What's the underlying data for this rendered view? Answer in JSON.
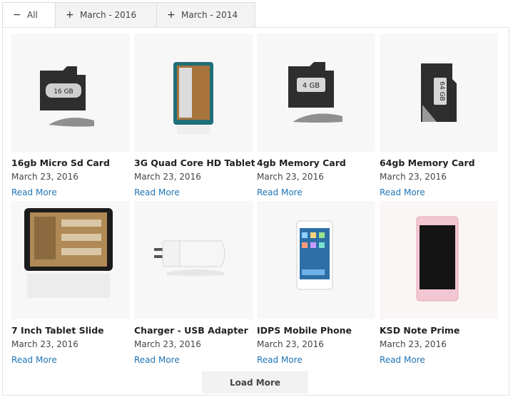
{
  "tabs": [
    {
      "sign": "−",
      "label": "All"
    },
    {
      "sign": "+",
      "label": "March - 2016"
    },
    {
      "sign": "+",
      "label": "March - 2014"
    }
  ],
  "products": [
    {
      "title": "16gb Micro Sd Card",
      "date": "March 23, 2016",
      "link": "Read More",
      "icon": "micro-sd-card-icon",
      "capacity": "16 GB"
    },
    {
      "title": "3G Quad Core HD Tablet",
      "date": "March 23, 2016",
      "link": "Read More",
      "icon": "tablet-icon"
    },
    {
      "title": "4gb Memory Card",
      "date": "March 23, 2016",
      "link": "Read More",
      "icon": "micro-sd-card-icon",
      "capacity": "4 GB"
    },
    {
      "title": "64gb Memory Card",
      "date": "March 23, 2016",
      "link": "Read More",
      "icon": "micro-sd-card-icon",
      "capacity": "64 GB"
    },
    {
      "title": "7 Inch Tablet Slide",
      "date": "March 23, 2016",
      "link": "Read More",
      "icon": "tablet-icon"
    },
    {
      "title": "Charger - USB Adapter",
      "date": "March 23, 2016",
      "link": "Read More",
      "icon": "charger-icon"
    },
    {
      "title": "IDPS Mobile Phone",
      "date": "March 23, 2016",
      "link": "Read More",
      "icon": "smartphone-icon"
    },
    {
      "title": "KSD Note Prime",
      "date": "March 23, 2016",
      "link": "Read More",
      "icon": "smartphone-icon"
    }
  ],
  "load_more": "Load More",
  "colors": {
    "link": "#1f74b5",
    "tab_bg": "#f3f3f3",
    "thumb_bg": "#f7f7f7"
  }
}
